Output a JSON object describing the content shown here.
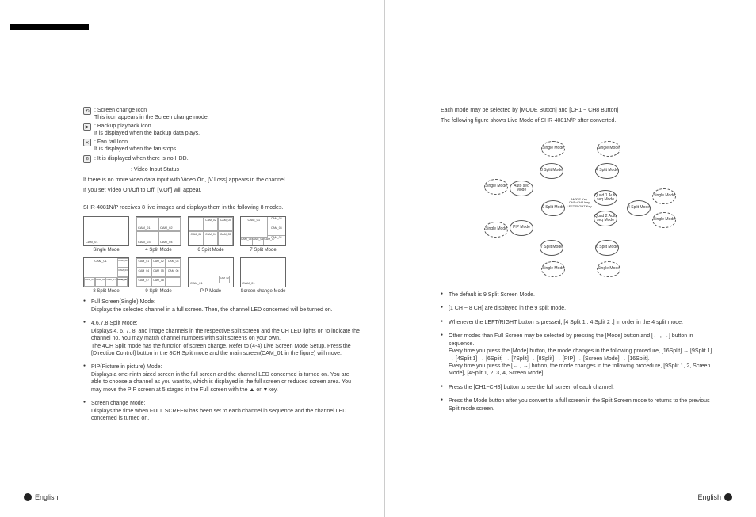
{
  "left": {
    "icons": [
      {
        "label": "Screen change Icon",
        "desc": "This icon appears in the Screen change mode."
      },
      {
        "label": "Backup playback icon",
        "desc": "It is displayed when the backup data plays."
      },
      {
        "label": "Fan fail Icon",
        "desc": "It is displayed when the fan stops."
      },
      {
        "label": "",
        "desc": "It is displayed when there is no HDD."
      }
    ],
    "video_status_label": ": Video Input Status",
    "video_status_1": "If there is no more video data input with Video On, [V.Loss] appears in the channel.",
    "video_status_2": "If you set Video On/Off to Off, [V.Off] will appear.",
    "modes_intro": "SHR-4081N/P receives 8 live images and displays them in the following 8 modes.",
    "mode_labels": {
      "single": "Single Mode",
      "split4": "4 Split Mode",
      "split6": "6 Split Mode",
      "split7": "7 Split Mode",
      "split8": "8 Split Mode",
      "split9": "9 Split Mode",
      "pip": "PIP Mode",
      "screen_change": "Screen change Mode"
    },
    "cam": "CAM_01",
    "bullets": [
      {
        "title": "Full Screen(Single) Mode:",
        "body": "Displays the selected channel in a full screen. Then, the channel LED concerned will be turned on."
      },
      {
        "title": "4,6,7,8 Split Mode:",
        "body": "Displays 4, 6, 7, 8, and image channels in the respective split screen and the CH LED lights on to indicate the channel no. You may match channel numbers with split screens on your own.\nThe 4CH Split mode has the function of screen change. Refer to (4-4) Live Screen Mode Setup. Press the [Direction Control] button in the 8CH Split mode and the main screen(CAM_01 in the figure) will move."
      },
      {
        "title": "PIP(Picture in picture) Mode:",
        "body": "Displays a one-ninth sized screen in the full screen and the channel LED concerned is turned on. You are able to choose a channel as you want to, which is displayed in the full screen or reduced screen area. You may move the PIP screen at 5 stages in the Full screen with the ▲ or ▼key."
      },
      {
        "title": "Screen change Mode:",
        "body": "Displays the time when FULL SCREEN has been set to each channel in sequence and the channel LED concerned is turned on."
      }
    ],
    "footer": "English"
  },
  "right": {
    "intro1": "Each mode may be selected by [MODE Button] and [CH1 ~ CH8 Button]",
    "intro2": "The following figure shows Live Mode of SHR-4081N/P after converted.",
    "diagram_nodes": {
      "center_left": "9 Split Mode",
      "center_right_top": "Quad 1 Auto seq Mode",
      "center_right_bot": "Quad 2 Auto seq Mode",
      "pip": "PIP Mode",
      "auto": "Auto seq Mode",
      "single": "Single Mode",
      "s4": "4 Split Mode",
      "s6": "6 Split Mode",
      "s7": "7 Split Mode",
      "s8": "8 Split Mode",
      "key_label": "MODE Key CH1~CH8 Key LEFT/RIGHT Key"
    },
    "bullets": [
      "The default is 9 Split Screen Mode.",
      "[1 CH ~ 8 CH] are displayed in the 9 split mode.",
      "Whenever the LEFT/RIGHT button is pressed, [4 Split 1 . 4 Split 2 .] in order in the 4 split mode.",
      "Other modes than Full Screen may be selected by pressing the [Mode] button and [← , →] button in sequence.\nEvery time you press the [Mode] button, the mode changes in the following procedure, [16Split] → [9Split 1] → [4Split 1] → [6Split] → [7Split] → [8Split] → [PIP] → [Screen Mode] → [16Split].\nEvery time you press the [← , →] button, the mode changes in the following procedure, [9Split 1, 2, Screen Mode], [4Split 1, 2, 3, 4, Screen Mode].",
      "Press the [CH1~CH8] button to see the full screen of each channel.",
      "Press the Mode button after you convert to a full screen in the Split Screen mode to returns to the previous Split mode screen."
    ],
    "footer": "English"
  }
}
